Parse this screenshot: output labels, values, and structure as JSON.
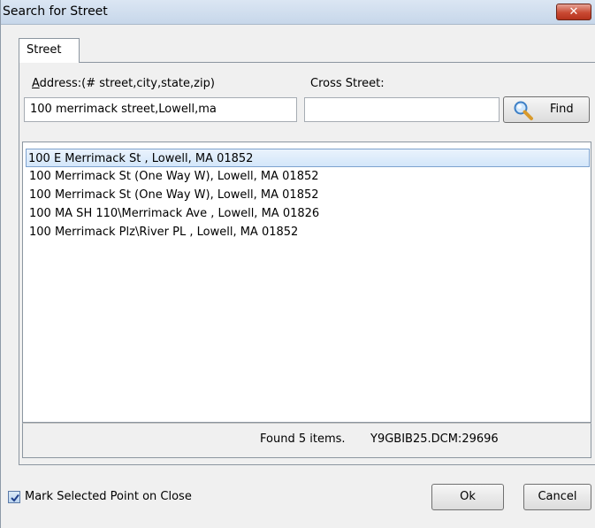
{
  "window": {
    "title": "Search for Street",
    "close_glyph": "✕"
  },
  "tabs": [
    {
      "label": "Street",
      "active": true
    }
  ],
  "address": {
    "label": "Address:(# street,city,state,zip)",
    "value": "100 merrimack street,Lowell,ma"
  },
  "cross_street": {
    "label": "Cross Street:",
    "value": ""
  },
  "find_button": {
    "label": "Find",
    "icon": "magnifier-icon"
  },
  "results": [
    "100 E Merrimack St , Lowell, MA 01852",
    "100 Merrimack St (One Way W), Lowell, MA 01852",
    "100 Merrimack St (One Way W), Lowell, MA 01852",
    "100 MA  SH 110\\Merrimack Ave , Lowell, MA 01826",
    "100 Merrimack Plz\\River PL , Lowell, MA 01852"
  ],
  "selected_index": 0,
  "status": {
    "found": "Found 5 items.",
    "file": "Y9GBIB25.DCM:29696"
  },
  "mark_selected": {
    "label": "Mark Selected Point on Close",
    "checked": true
  },
  "buttons": {
    "ok": "Ok",
    "cancel": "Cancel"
  },
  "colors": {
    "selection_border": "#7da2ce",
    "close_button": "#c94a33",
    "titlebar": "#c7d7ea"
  }
}
